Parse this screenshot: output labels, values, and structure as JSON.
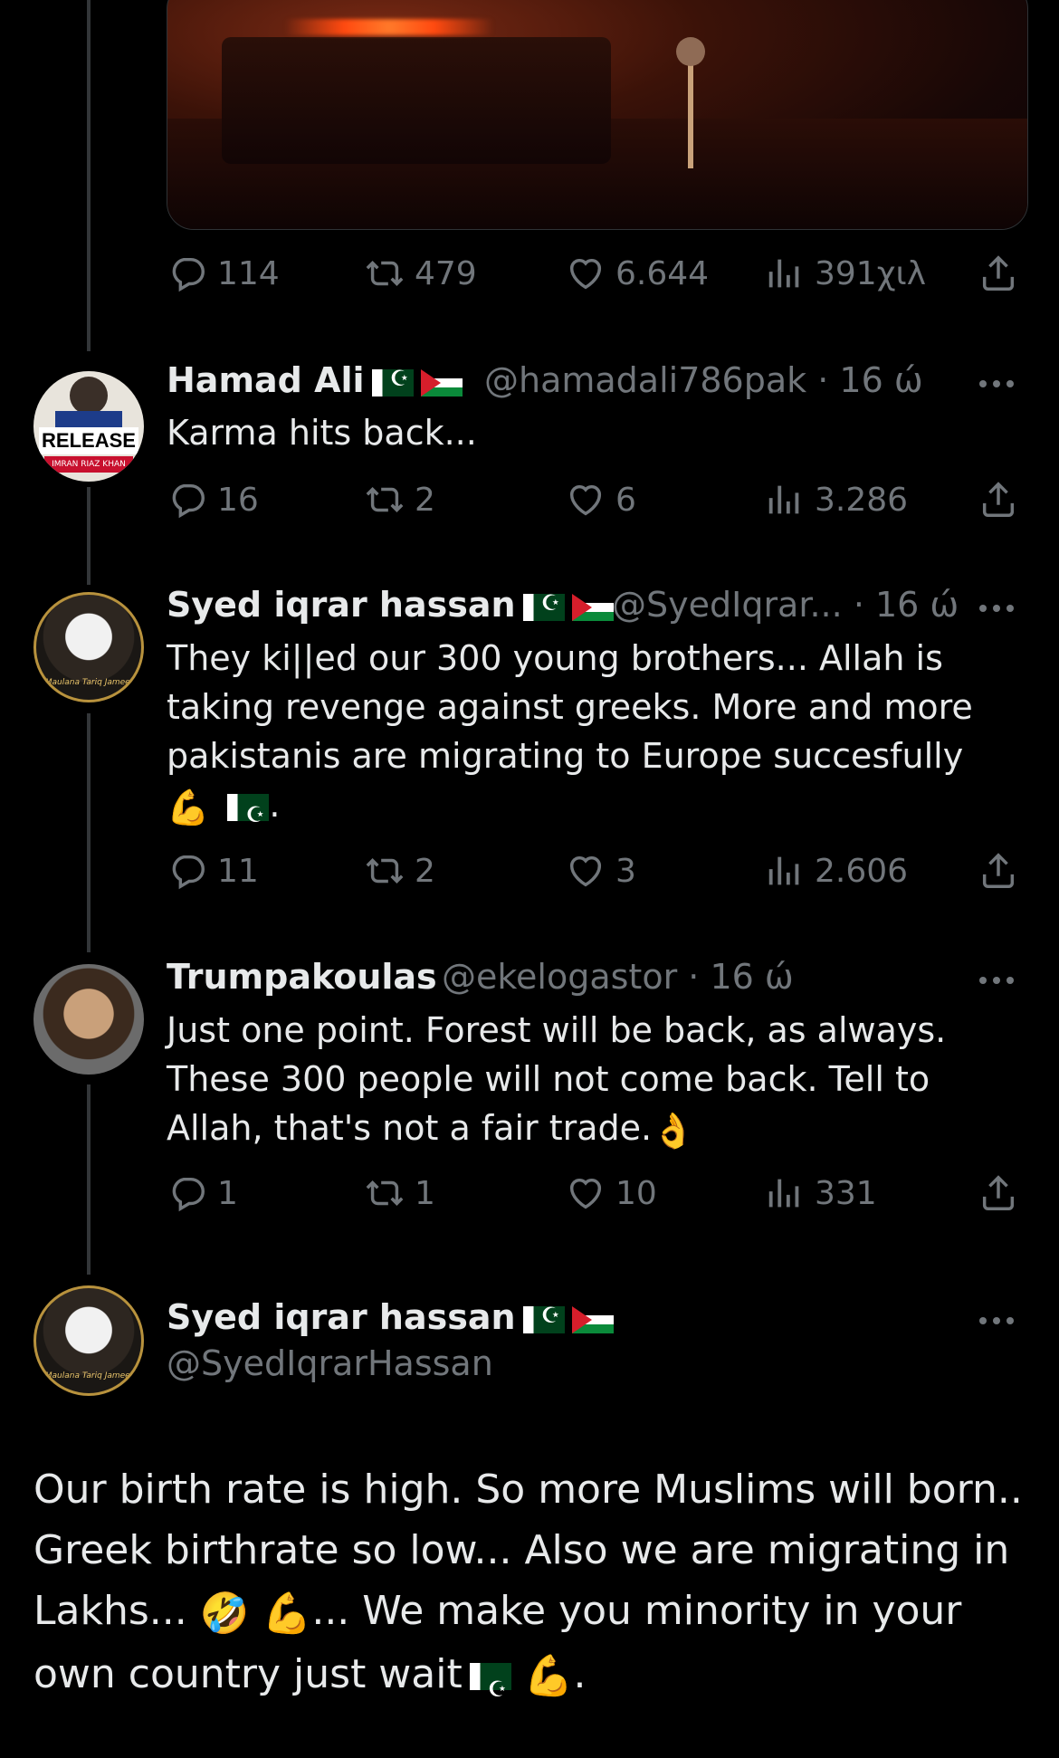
{
  "tweet0": {
    "actions": {
      "replies": "114",
      "retweets": "479",
      "likes": "6.644",
      "views": "391χιλ"
    }
  },
  "tweet1": {
    "name": "Hamad Ali",
    "handle": "@hamadali786pak",
    "time": "· 16 ώ",
    "text": "Karma hits back...",
    "avatar_text": "RELEASE",
    "avatar_subtext": "IMRAN RIAZ KHAN",
    "actions": {
      "replies": "16",
      "retweets": "2",
      "likes": "6",
      "views": "3.286"
    }
  },
  "tweet2": {
    "name": "Syed iqrar hassan",
    "handle": "@SyedIqrar...",
    "time": "· 16 ώ",
    "text": "They ki||ed our 300 young brothers... Allah is taking revenge against greeks. More and more pakistanis are migrating to Europe succesfully",
    "emoji_line": "💪",
    "avatar_caption": "Maulana Tariq Jameel",
    "actions": {
      "replies": "11",
      "retweets": "2",
      "likes": "3",
      "views": "2.606"
    }
  },
  "tweet3": {
    "name": "Trumpakoulas",
    "handle": "@ekelogastor",
    "time": "· 16 ώ",
    "text": "Just one point. Forest will be back, as always. These 300 people will not come back. Tell to Allah, that's not a fair trade.",
    "emoji": "👌",
    "actions": {
      "replies": "1",
      "retweets": "1",
      "likes": "10",
      "views": "331"
    }
  },
  "tweet4": {
    "name": "Syed iqrar hassan",
    "handle": "@SyedIqrarHassan",
    "text_part1": "Our birth rate is high. So more Muslims will born.. Greek birthrate so low... Also we are migrating in Lakhs...",
    "emoji1": "🤣",
    "emoji2": "💪",
    "text_part2": "... We make you minority in your own country just wait",
    "emoji3": "💪",
    "avatar_caption": "Maulana Tariq Jameel"
  },
  "colors": {
    "background": "#000000",
    "text": "#e7e9ea",
    "muted": "#71767b",
    "thread_line": "#333639"
  },
  "icons": [
    "reply-icon",
    "retweet-icon",
    "like-icon",
    "views-icon",
    "share-icon",
    "more-icon"
  ]
}
